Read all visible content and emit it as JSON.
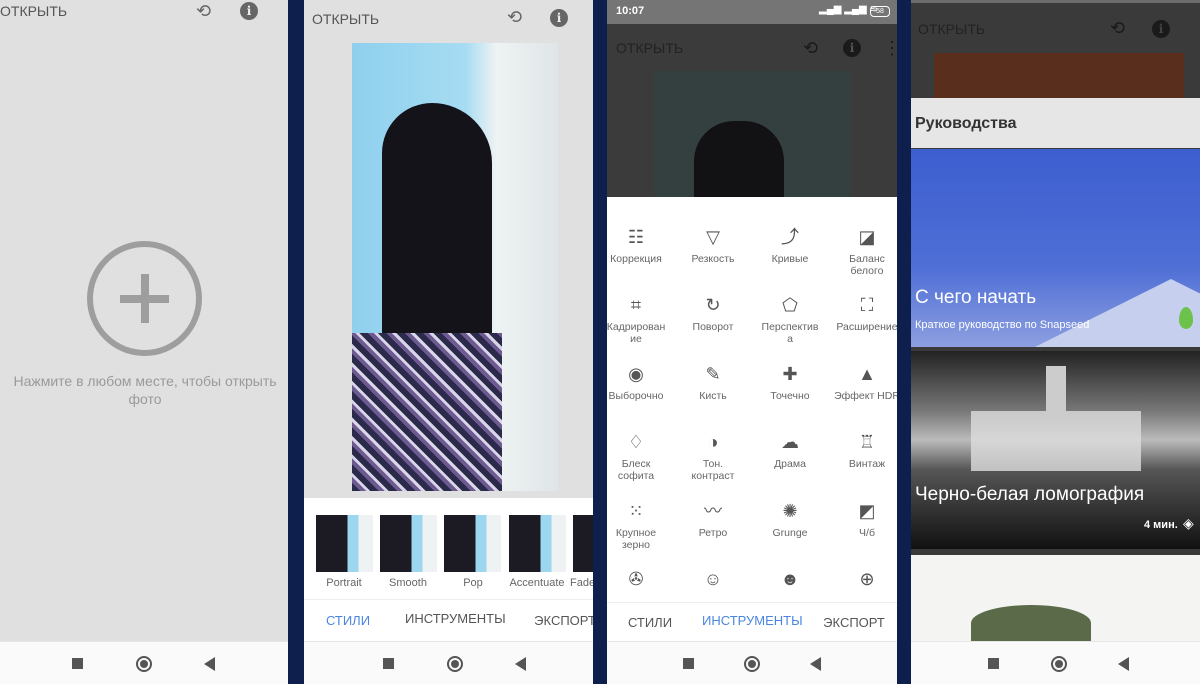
{
  "panel1": {
    "open_label": "ОТКРЫТЬ",
    "hint": "Нажмите в любом месте, чтобы открыть фото",
    "icons": [
      "layers-rotate-icon",
      "info-icon",
      "more-vert-icon",
      "add-circle-icon"
    ]
  },
  "panel2": {
    "open_label": "ОТКРЫТЬ",
    "styles": [
      "Portrait",
      "Smooth",
      "Pop",
      "Accentuate",
      "Fade"
    ],
    "tabs": [
      "СТИЛИ",
      "ИНСТРУМЕНТЫ",
      "ЭКСПОРТ"
    ],
    "active_tab": "СТИЛИ"
  },
  "panel3": {
    "time": "10:07",
    "battery": "58",
    "open_label": "ОТКРЫТЬ",
    "tools": [
      {
        "label": "Коррекция",
        "icon": "tune-icon"
      },
      {
        "label": "Резкость",
        "icon": "triangle-icon"
      },
      {
        "label": "Кривые",
        "icon": "curves-icon"
      },
      {
        "label": "Баланс\nбелого",
        "icon": "white-balance-icon"
      },
      {
        "label": "Кадрирован\nие",
        "icon": "crop-icon"
      },
      {
        "label": "Поворот",
        "icon": "rotate-icon"
      },
      {
        "label": "Перспектив\nа",
        "icon": "perspective-icon"
      },
      {
        "label": "Расширение",
        "icon": "expand-icon"
      },
      {
        "label": "Выборочно",
        "icon": "selective-icon"
      },
      {
        "label": "Кисть",
        "icon": "brush-icon"
      },
      {
        "label": "Точечно",
        "icon": "healing-icon"
      },
      {
        "label": "Эффект HDR",
        "icon": "hdr-mountains-icon"
      },
      {
        "label": "Блеск\nсофита",
        "icon": "glamour-glow-icon"
      },
      {
        "label": "Тон.\nконтраст",
        "icon": "tonal-contrast-icon"
      },
      {
        "label": "Драма",
        "icon": "drama-cloud-icon"
      },
      {
        "label": "Винтаж",
        "icon": "vintage-lamp-icon"
      },
      {
        "label": "Крупное\nзерно",
        "icon": "grainy-film-icon"
      },
      {
        "label": "Ретро",
        "icon": "mustache-icon"
      },
      {
        "label": "Grunge",
        "icon": "grunge-icon"
      },
      {
        "label": "Ч/б",
        "icon": "black-white-icon"
      },
      {
        "label": "",
        "icon": "film-reel-icon"
      },
      {
        "label": "",
        "icon": "face-icon"
      },
      {
        "label": "",
        "icon": "face-pose-icon"
      },
      {
        "label": "",
        "icon": "lens-blur-icon"
      }
    ],
    "tabs": [
      "СТИЛИ",
      "ИНСТРУМЕНТЫ",
      "ЭКСПОРТ"
    ],
    "active_tab": "ИНСТРУМЕНТЫ"
  },
  "panel4": {
    "open_label": "ОТКРЫТЬ",
    "section_title": "Руководства",
    "cards": [
      {
        "title": "С чего начать",
        "subtitle": "Краткое руководство по Snapseed"
      },
      {
        "title": "Черно-белая ломография",
        "duration": "4 мин."
      }
    ]
  },
  "colors": {
    "accent": "#4a86e0",
    "divider": "#0f1f4d"
  }
}
